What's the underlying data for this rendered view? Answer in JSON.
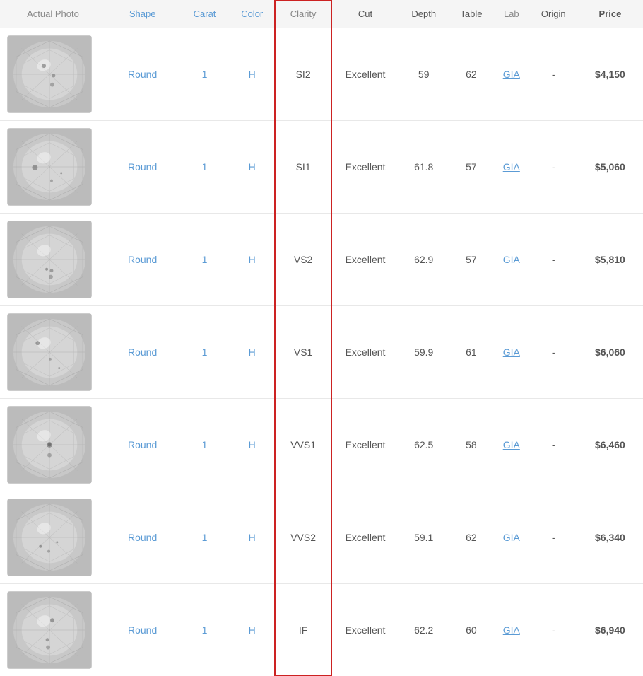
{
  "header": {
    "columns": [
      {
        "key": "photo",
        "label": "Actual Photo"
      },
      {
        "key": "shape",
        "label": "Shape"
      },
      {
        "key": "carat",
        "label": "Carat"
      },
      {
        "key": "color",
        "label": "Color"
      },
      {
        "key": "clarity",
        "label": "Clarity"
      },
      {
        "key": "cut",
        "label": "Cut"
      },
      {
        "key": "depth",
        "label": "Depth"
      },
      {
        "key": "table",
        "label": "Table"
      },
      {
        "key": "lab",
        "label": "Lab"
      },
      {
        "key": "origin",
        "label": "Origin"
      },
      {
        "key": "price",
        "label": "Price"
      }
    ]
  },
  "rows": [
    {
      "shape": "Round",
      "carat": "1",
      "color": "H",
      "clarity": "SI2",
      "cut": "Excellent",
      "depth": "59",
      "table": "62",
      "lab": "GIA",
      "origin": "-",
      "price": "$4,150"
    },
    {
      "shape": "Round",
      "carat": "1",
      "color": "H",
      "clarity": "SI1",
      "cut": "Excellent",
      "depth": "61.8",
      "table": "57",
      "lab": "GIA",
      "origin": "-",
      "price": "$5,060"
    },
    {
      "shape": "Round",
      "carat": "1",
      "color": "H",
      "clarity": "VS2",
      "cut": "Excellent",
      "depth": "62.9",
      "table": "57",
      "lab": "GIA",
      "origin": "-",
      "price": "$5,810"
    },
    {
      "shape": "Round",
      "carat": "1",
      "color": "H",
      "clarity": "VS1",
      "cut": "Excellent",
      "depth": "59.9",
      "table": "61",
      "lab": "GIA",
      "origin": "-",
      "price": "$6,060"
    },
    {
      "shape": "Round",
      "carat": "1",
      "color": "H",
      "clarity": "VVS1",
      "cut": "Excellent",
      "depth": "62.5",
      "table": "58",
      "lab": "GIA",
      "origin": "-",
      "price": "$6,460"
    },
    {
      "shape": "Round",
      "carat": "1",
      "color": "H",
      "clarity": "VVS2",
      "cut": "Excellent",
      "depth": "59.1",
      "table": "62",
      "lab": "GIA",
      "origin": "-",
      "price": "$6,340"
    },
    {
      "shape": "Round",
      "carat": "1",
      "color": "H",
      "clarity": "IF",
      "cut": "Excellent",
      "depth": "62.2",
      "table": "60",
      "lab": "GIA",
      "origin": "-",
      "price": "$6,940"
    }
  ]
}
